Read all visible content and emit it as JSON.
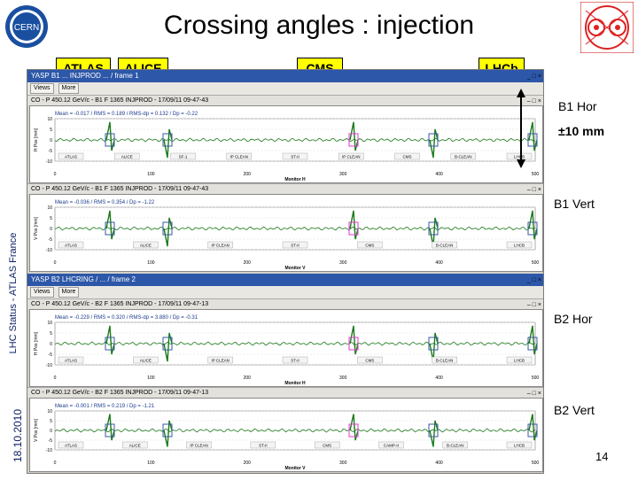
{
  "title": "Crossing angles : injection",
  "side_status": "LHC Status - ATLAS France",
  "side_date": "18.10.2010",
  "page_number": "14",
  "logos": {
    "left": "CERN",
    "right": "LHC"
  },
  "experiments": [
    "ATLAS",
    "ALICE",
    "CMS",
    "LHCb"
  ],
  "colors": {
    "accent_yellow": "#ffff00",
    "trace_green": "#1a7a1a",
    "title_bar": "#2d57a8",
    "marker_blue": "#3a5aa0",
    "marker_pink": "#e23ad0"
  },
  "annotations": {
    "b1_hor": "B1 Hor",
    "scale": "±10 mm",
    "b1_vert": "B1 Vert",
    "b2_hor": "B2 Hor",
    "b2_vert": "B2 Vert"
  },
  "windows": [
    {
      "title": "YASP B1 ... INJPROD ... / frame 1",
      "toolbar": [
        "Views",
        "More"
      ],
      "panels": [
        {
          "subbar": "CO - P 450.12 GeV/c - B1 F 1365 INJPROD - 17/09/11 09-47-43",
          "stats": "Mean = -0.017  /  RMS = 0.189  /  RMS-dp = 0.132  /  Dp = -0.22",
          "ylabel": "H Pos [mm]",
          "xlabel": "Monitor H",
          "yticks": [
            "10",
            "5",
            "0",
            "-5",
            "-10"
          ],
          "xticks": [
            "0",
            "100",
            "200",
            "300",
            "400",
            "500"
          ],
          "markers": [
            "ATLAS",
            "ALICE",
            "SF-1",
            "IP CLEAN",
            "ST-II",
            "IP CLEAN",
            "CMS",
            "B-CLEAN",
            "LHCB"
          ]
        },
        {
          "subbar": "CO - P 450.12 GeV/c - B1 F 1365 INJPROD - 17/09/11 09-47-43",
          "stats": "Mean = -0.036  /  RMS = 0.354  /  Dp = -1.22",
          "ylabel": "V Pos [mm]",
          "xlabel": "Monitor V",
          "yticks": [
            "10",
            "5",
            "0",
            "-5",
            "-10"
          ],
          "xticks": [
            "0",
            "100",
            "200",
            "300",
            "400",
            "500"
          ],
          "markers": [
            "ATLAS",
            "ALICE",
            "IP CLEAN",
            "ST-II",
            "CMS",
            "B-CLEAN",
            "LHCB"
          ]
        }
      ]
    },
    {
      "title": "YASP B2 LHCRING / ... / frame 2",
      "toolbar": [
        "Views",
        "More"
      ],
      "panels": [
        {
          "subbar": "CO - P 450.12 GeV/c - B2 F 1365 INJPROD - 17/09/11 09-47-13",
          "stats": "Mean = -0.229  /  RMS = 0.320  /  RMS-dp = 3.880  /  Dp = -0.31",
          "ylabel": "H Pos [mm]",
          "xlabel": "Monitor H",
          "yticks": [
            "10",
            "5",
            "0",
            "-5",
            "-10"
          ],
          "xticks": [
            "0",
            "100",
            "200",
            "300",
            "400",
            "500"
          ],
          "markers": [
            "ATLAS",
            "ALICE",
            "IP CLEAN",
            "ST-II",
            "CMS",
            "B-CLEAN",
            "LHCB"
          ]
        },
        {
          "subbar": "CO - P 450.12 GeV/c - B2 F 1365 INJPROD - 17/09/11 09-47-13",
          "stats": "Mean = -0.001  /  RMS = 0.219  /  Dp = -1.21",
          "ylabel": "V Pos [mm]",
          "xlabel": "Monitor V",
          "yticks": [
            "10",
            "5",
            "0",
            "-5",
            "-10"
          ],
          "xticks": [
            "0",
            "100",
            "200",
            "300",
            "400",
            "500"
          ],
          "markers": [
            "ATLAS",
            "ALICE",
            "IP CLEAN",
            "ST-II",
            "CMS",
            "CAMP-II",
            "B-CLEAN",
            "LHCB"
          ]
        }
      ]
    }
  ]
}
